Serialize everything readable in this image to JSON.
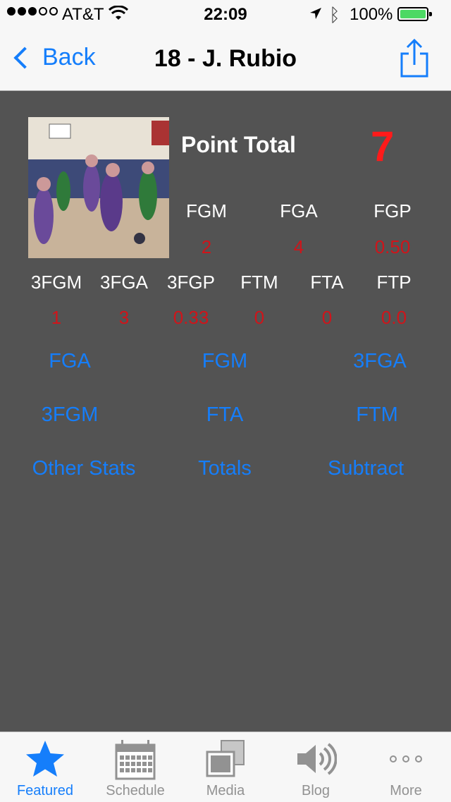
{
  "status_bar": {
    "carrier": "AT&T",
    "time": "22:09",
    "battery": "100%",
    "signal_bars": 3
  },
  "nav": {
    "back_label": "Back",
    "title": "18 - J. Rubio"
  },
  "player": {
    "point_total_label": "Point Total",
    "point_total": "7"
  },
  "stats_row1": [
    {
      "label": "FGM",
      "value": "2"
    },
    {
      "label": "FGA",
      "value": "4"
    },
    {
      "label": "FGP",
      "value": "0.50"
    }
  ],
  "stats_row2": [
    {
      "label": "3FGM",
      "value": "1"
    },
    {
      "label": "3FGA",
      "value": "3"
    },
    {
      "label": "3FGP",
      "value": "0.33"
    },
    {
      "label": "FTM",
      "value": "0"
    },
    {
      "label": "FTA",
      "value": "0"
    },
    {
      "label": "FTP",
      "value": "0.0"
    }
  ],
  "actions": {
    "fga": "FGA",
    "fgm": "FGM",
    "three_fga": "3FGA",
    "three_fgm": "3FGM",
    "fta": "FTA",
    "ftm": "FTM",
    "other_stats": "Other Stats",
    "totals": "Totals",
    "subtract": "Subtract"
  },
  "tabs": [
    {
      "label": "Featured",
      "icon": "star-icon",
      "active": true
    },
    {
      "label": "Schedule",
      "icon": "calendar-icon",
      "active": false
    },
    {
      "label": "Media",
      "icon": "media-icon",
      "active": false
    },
    {
      "label": "Blog",
      "icon": "speaker-icon",
      "active": false
    },
    {
      "label": "More",
      "icon": "more-icon",
      "active": false
    }
  ],
  "colors": {
    "accent": "#157efb",
    "stat_value": "#d0141a",
    "point_total": "#ff1a1a",
    "background": "#535353"
  }
}
